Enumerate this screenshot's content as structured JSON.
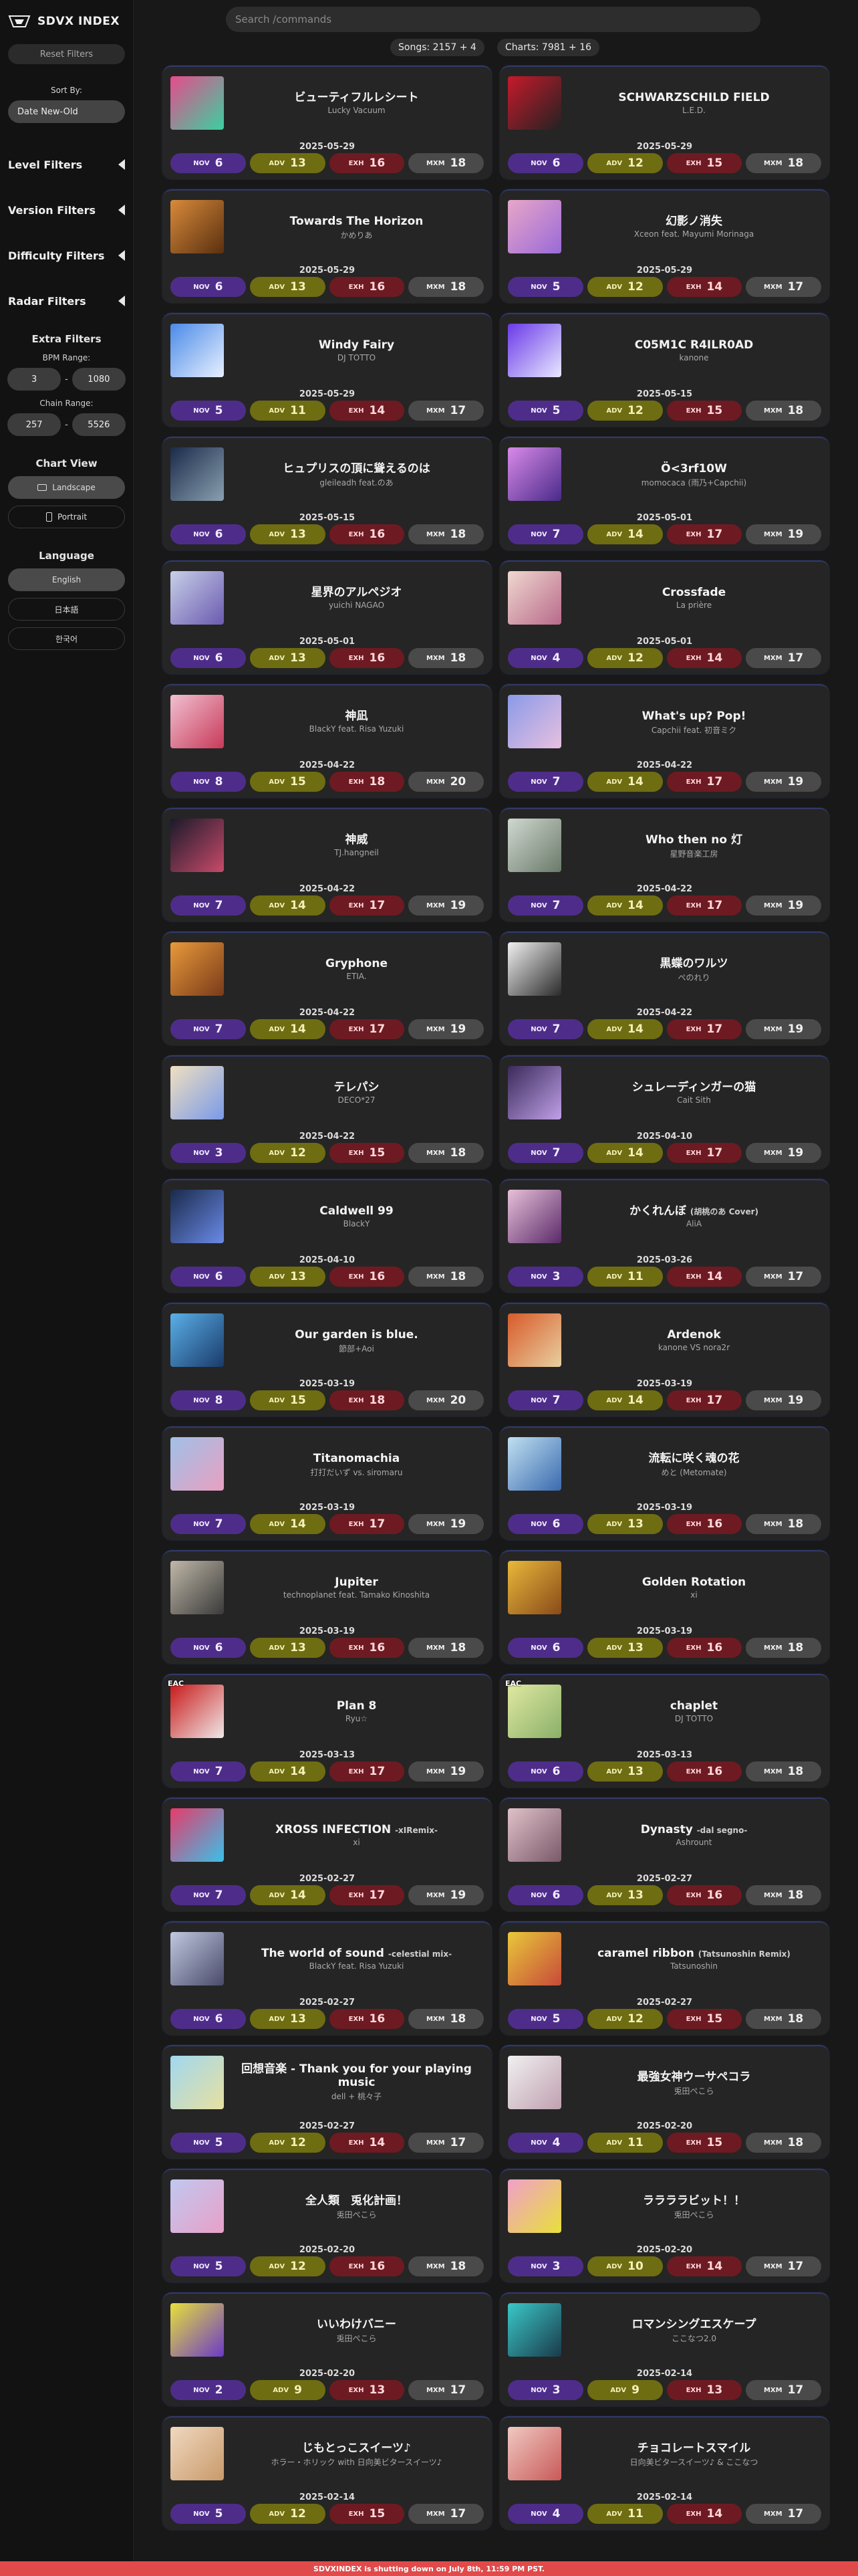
{
  "brand": {
    "name": "SDVX INDEX"
  },
  "sidebar": {
    "reset_label": "Reset Filters",
    "sort_label": "Sort By:",
    "sort_value": "Date New-Old",
    "sections": [
      "Level Filters",
      "Version Filters",
      "Difficulty Filters",
      "Radar Filters"
    ],
    "extra_title": "Extra Filters",
    "bpm_label": "BPM Range:",
    "bpm_min": "3",
    "bpm_max": "1080",
    "chain_label": "Chain Range:",
    "chain_min": "257",
    "chain_max": "5526",
    "range_sep": "-",
    "chart_view_title": "Chart View",
    "landscape": "Landscape",
    "portrait": "Portrait",
    "language_title": "Language",
    "languages": [
      "English",
      "日本語",
      "한국어"
    ]
  },
  "search": {
    "placeholder": "Search /commands"
  },
  "stats": {
    "songs": "Songs: 2157 + 4",
    "charts": "Charts: 7981 + 16"
  },
  "difficulty_labels": [
    "NOV",
    "ADV",
    "EXH",
    "MXM"
  ],
  "colors": {
    "nov": "#4e2d8a",
    "adv": "#6e6d12",
    "exh": "#6e1a22",
    "mxm": "#4a4a4a",
    "card_border": "#31396a",
    "footer": "#e04a4a"
  },
  "songs": [
    {
      "title": "ビューティフルレシート",
      "sub": "",
      "artist": "Lucky Vacuum",
      "date": "2025-05-29",
      "levels": [
        6,
        13,
        16,
        18
      ],
      "tag": ""
    },
    {
      "title": "SCHWARZSCHILD FIELD",
      "sub": "",
      "artist": "L.E.D.",
      "date": "2025-05-29",
      "levels": [
        6,
        12,
        15,
        18
      ],
      "tag": ""
    },
    {
      "title": "Towards The Horizon",
      "sub": "",
      "artist": "かめりあ",
      "date": "2025-05-29",
      "levels": [
        6,
        13,
        16,
        18
      ],
      "tag": ""
    },
    {
      "title": "幻影ノ消失",
      "sub": "",
      "artist": "Xceon feat. Mayumi Morinaga",
      "date": "2025-05-29",
      "levels": [
        5,
        12,
        14,
        17
      ],
      "tag": ""
    },
    {
      "title": "Windy Fairy",
      "sub": "",
      "artist": "DJ TOTTO",
      "date": "2025-05-29",
      "levels": [
        5,
        11,
        14,
        17
      ],
      "tag": ""
    },
    {
      "title": "C05M1C R4ILR0AD",
      "sub": "",
      "artist": "kanone",
      "date": "2025-05-15",
      "levels": [
        5,
        12,
        15,
        18
      ],
      "tag": ""
    },
    {
      "title": "ヒュプリスの頂に聳えるのは",
      "sub": "",
      "artist": "gleileadh feat.のあ",
      "date": "2025-05-15",
      "levels": [
        6,
        13,
        16,
        18
      ],
      "tag": ""
    },
    {
      "title": "Ö<3rf10W",
      "sub": "",
      "artist": "momocaca (雨乃+Capchii)",
      "date": "2025-05-01",
      "levels": [
        7,
        14,
        17,
        19
      ],
      "tag": ""
    },
    {
      "title": "星界のアルペジオ",
      "sub": "",
      "artist": "yuichi NAGAO",
      "date": "2025-05-01",
      "levels": [
        6,
        13,
        16,
        18
      ],
      "tag": ""
    },
    {
      "title": "Crossfade",
      "sub": "",
      "artist": "La prière",
      "date": "2025-05-01",
      "levels": [
        4,
        12,
        14,
        17
      ],
      "tag": ""
    },
    {
      "title": "神凪",
      "sub": "",
      "artist": "BlackY feat. Risa Yuzuki",
      "date": "2025-04-22",
      "levels": [
        8,
        15,
        18,
        20
      ],
      "tag": ""
    },
    {
      "title": "What's up? Pop!",
      "sub": "",
      "artist": "Capchii feat. 初音ミク",
      "date": "2025-04-22",
      "levels": [
        7,
        14,
        17,
        19
      ],
      "tag": ""
    },
    {
      "title": "神威",
      "sub": "",
      "artist": "TJ.hangneil",
      "date": "2025-04-22",
      "levels": [
        7,
        14,
        17,
        19
      ],
      "tag": ""
    },
    {
      "title": "Who then no 灯",
      "sub": "",
      "artist": "星野音楽工房",
      "date": "2025-04-22",
      "levels": [
        7,
        14,
        17,
        19
      ],
      "tag": ""
    },
    {
      "title": "Gryphone",
      "sub": "",
      "artist": "ETIA.",
      "date": "2025-04-22",
      "levels": [
        7,
        14,
        17,
        19
      ],
      "tag": ""
    },
    {
      "title": "黒蝶のワルツ",
      "sub": "",
      "artist": "ぺのれり",
      "date": "2025-04-22",
      "levels": [
        7,
        14,
        17,
        19
      ],
      "tag": ""
    },
    {
      "title": "テレパシ",
      "sub": "",
      "artist": "DECO*27",
      "date": "2025-04-22",
      "levels": [
        3,
        12,
        15,
        18
      ],
      "tag": ""
    },
    {
      "title": "シュレーディンガーの猫",
      "sub": "",
      "artist": "Cait Sith",
      "date": "2025-04-10",
      "levels": [
        7,
        14,
        17,
        19
      ],
      "tag": ""
    },
    {
      "title": "Caldwell 99",
      "sub": "",
      "artist": "BlackY",
      "date": "2025-04-10",
      "levels": [
        6,
        13,
        16,
        18
      ],
      "tag": ""
    },
    {
      "title": "かくれんぼ",
      "sub": "(胡桃のあ Cover)",
      "artist": "AliA",
      "date": "2025-03-26",
      "levels": [
        3,
        11,
        14,
        17
      ],
      "tag": ""
    },
    {
      "title": "Our garden is blue.",
      "sub": "",
      "artist": "節部+Aoi",
      "date": "2025-03-19",
      "levels": [
        8,
        15,
        18,
        20
      ],
      "tag": ""
    },
    {
      "title": "Ardenok",
      "sub": "",
      "artist": "kanone VS nora2r",
      "date": "2025-03-19",
      "levels": [
        7,
        14,
        17,
        19
      ],
      "tag": ""
    },
    {
      "title": "Titanomachia",
      "sub": "",
      "artist": "打打だいず vs. siromaru",
      "date": "2025-03-19",
      "levels": [
        7,
        14,
        17,
        19
      ],
      "tag": ""
    },
    {
      "title": "流転に咲く魂の花",
      "sub": "",
      "artist": "めと (Metomate)",
      "date": "2025-03-19",
      "levels": [
        6,
        13,
        16,
        18
      ],
      "tag": ""
    },
    {
      "title": "Jupiter",
      "sub": "",
      "artist": "technoplanet feat. Tamako Kinoshita",
      "date": "2025-03-19",
      "levels": [
        6,
        13,
        16,
        18
      ],
      "tag": ""
    },
    {
      "title": "Golden Rotation",
      "sub": "",
      "artist": "xi",
      "date": "2025-03-19",
      "levels": [
        6,
        13,
        16,
        18
      ],
      "tag": ""
    },
    {
      "title": "Plan 8",
      "sub": "",
      "artist": "Ryu☆",
      "date": "2025-03-13",
      "levels": [
        7,
        14,
        17,
        19
      ],
      "tag": "EAC"
    },
    {
      "title": "chaplet",
      "sub": "",
      "artist": "DJ TOTTO",
      "date": "2025-03-13",
      "levels": [
        6,
        13,
        16,
        18
      ],
      "tag": "EAC"
    },
    {
      "title": "XROSS INFECTION",
      "sub": "-xIRemix-",
      "artist": "xi",
      "date": "2025-02-27",
      "levels": [
        7,
        14,
        17,
        19
      ],
      "tag": ""
    },
    {
      "title": "Dynasty",
      "sub": "-dal segno-",
      "artist": "Ashrount",
      "date": "2025-02-27",
      "levels": [
        6,
        13,
        16,
        18
      ],
      "tag": ""
    },
    {
      "title": "The world of sound",
      "sub": "-celestial mix-",
      "artist": "BlackY feat. Risa Yuzuki",
      "date": "2025-02-27",
      "levels": [
        6,
        13,
        16,
        18
      ],
      "tag": ""
    },
    {
      "title": "caramel ribbon",
      "sub": "(Tatsunoshin Remix)",
      "artist": "Tatsunoshin",
      "date": "2025-02-27",
      "levels": [
        5,
        12,
        15,
        18
      ],
      "tag": ""
    },
    {
      "title": "回想音楽 - Thank you for your playing music",
      "sub": "",
      "artist": "dell + 桃々子",
      "date": "2025-02-27",
      "levels": [
        5,
        12,
        14,
        17
      ],
      "tag": ""
    },
    {
      "title": "最強女神ウーサペコラ",
      "sub": "",
      "artist": "兎田ぺこら",
      "date": "2025-02-20",
      "levels": [
        4,
        11,
        15,
        18
      ],
      "tag": ""
    },
    {
      "title": "全人類　兎化計画！",
      "sub": "",
      "artist": "兎田ぺこら",
      "date": "2025-02-20",
      "levels": [
        5,
        12,
        16,
        18
      ],
      "tag": ""
    },
    {
      "title": "ララララビット！！",
      "sub": "",
      "artist": "兎田ぺこら",
      "date": "2025-02-20",
      "levels": [
        3,
        10,
        14,
        17
      ],
      "tag": ""
    },
    {
      "title": "いいわけバニー",
      "sub": "",
      "artist": "兎田ぺこら",
      "date": "2025-02-20",
      "levels": [
        2,
        9,
        13,
        17
      ],
      "tag": ""
    },
    {
      "title": "ロマンシングエスケープ",
      "sub": "",
      "artist": "ここなつ2.0",
      "date": "2025-02-14",
      "levels": [
        3,
        9,
        13,
        17
      ],
      "tag": ""
    },
    {
      "title": "じもとっこスイーツ♪",
      "sub": "",
      "artist": "ホラー・ホリック with 日向美ビタースイーツ♪",
      "date": "2025-02-14",
      "levels": [
        5,
        12,
        15,
        17
      ],
      "tag": ""
    },
    {
      "title": "チョコレートスマイル",
      "sub": "",
      "artist": "日向美ビタースイーツ♪ & ここなつ",
      "date": "2025-02-14",
      "levels": [
        4,
        11,
        14,
        17
      ],
      "tag": ""
    }
  ],
  "footer": {
    "text": "SDVXINDEX is shutting down on July 8th, 11:59 PM PST."
  }
}
